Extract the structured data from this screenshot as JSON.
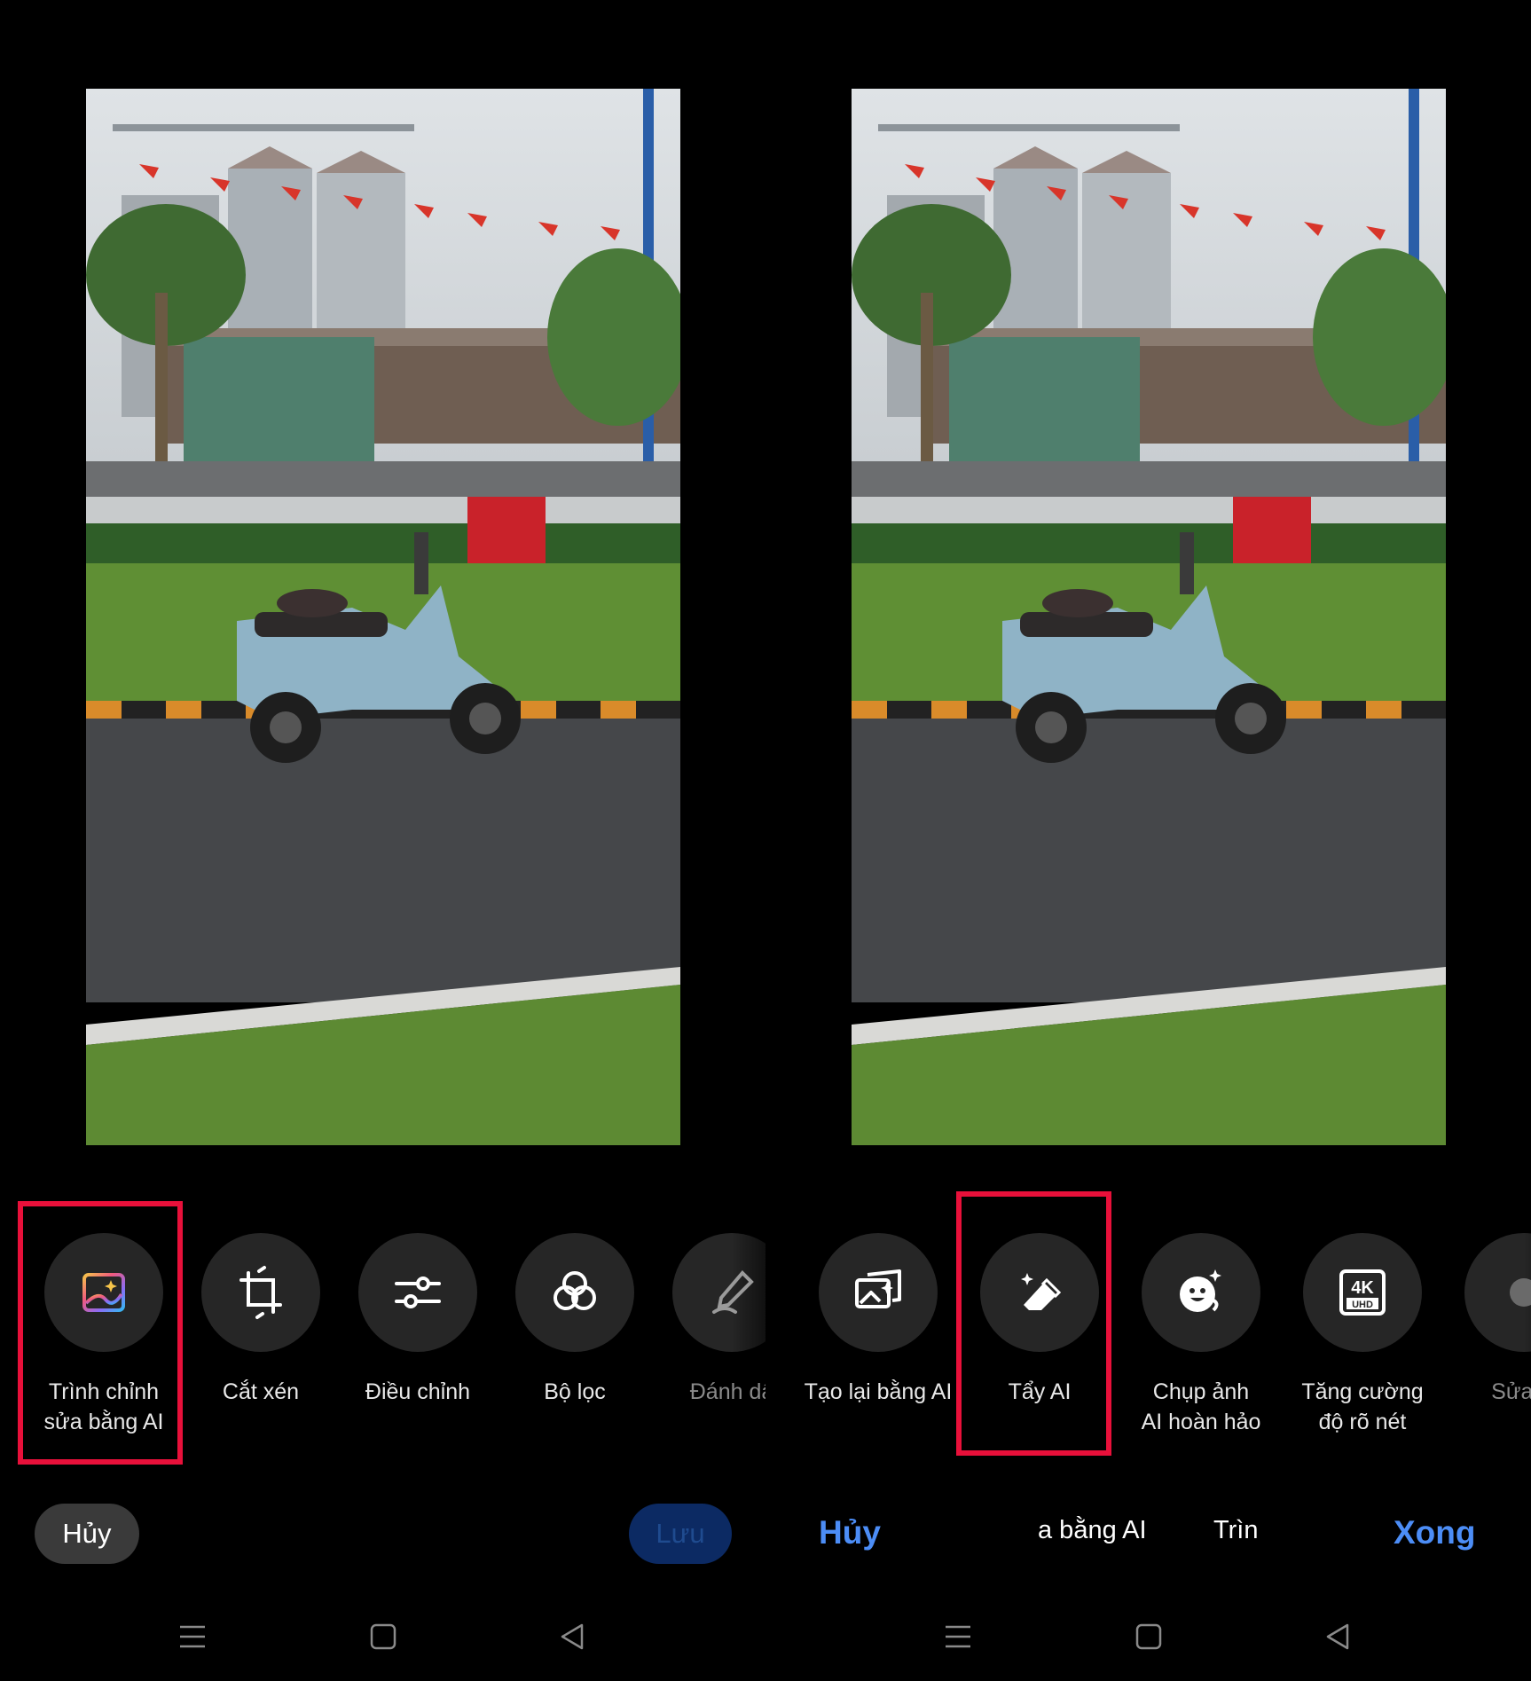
{
  "left_panel": {
    "tools": [
      {
        "label": "Trình chỉnh\nsửa bằng AI",
        "icon": "ai-image-edit-icon"
      },
      {
        "label": "Cắt xén",
        "icon": "crop-icon"
      },
      {
        "label": "Điều chỉnh",
        "icon": "sliders-icon"
      },
      {
        "label": "Bộ lọc",
        "icon": "filter-circles-icon"
      },
      {
        "label": "Đánh dấ",
        "icon": "pen-markup-icon"
      }
    ],
    "cancel_label": "Hủy",
    "save_label": "Lưu"
  },
  "right_panel": {
    "tools": [
      {
        "label": "Tạo lại bằng AI",
        "icon": "ai-regenerate-icon"
      },
      {
        "label": "Tẩy AI",
        "icon": "ai-eraser-icon"
      },
      {
        "label": "Chụp ảnh\nAI hoàn hảo",
        "icon": "ai-perfect-face-icon"
      },
      {
        "label": "Tăng cường\nđộ rõ nét",
        "icon": "4k-uhd-icon"
      },
      {
        "label": "Sửa lỗ",
        "icon": "repair-icon"
      }
    ],
    "cancel_label": "Hủy",
    "done_label": "Xong",
    "tab_partial_1": "a bằng AI",
    "tab_partial_2": "Trìn",
    "badge_4k": "4K",
    "badge_uhd": "UHD"
  },
  "highlight_color": "#e8103a",
  "accent_color": "#4c8df6"
}
